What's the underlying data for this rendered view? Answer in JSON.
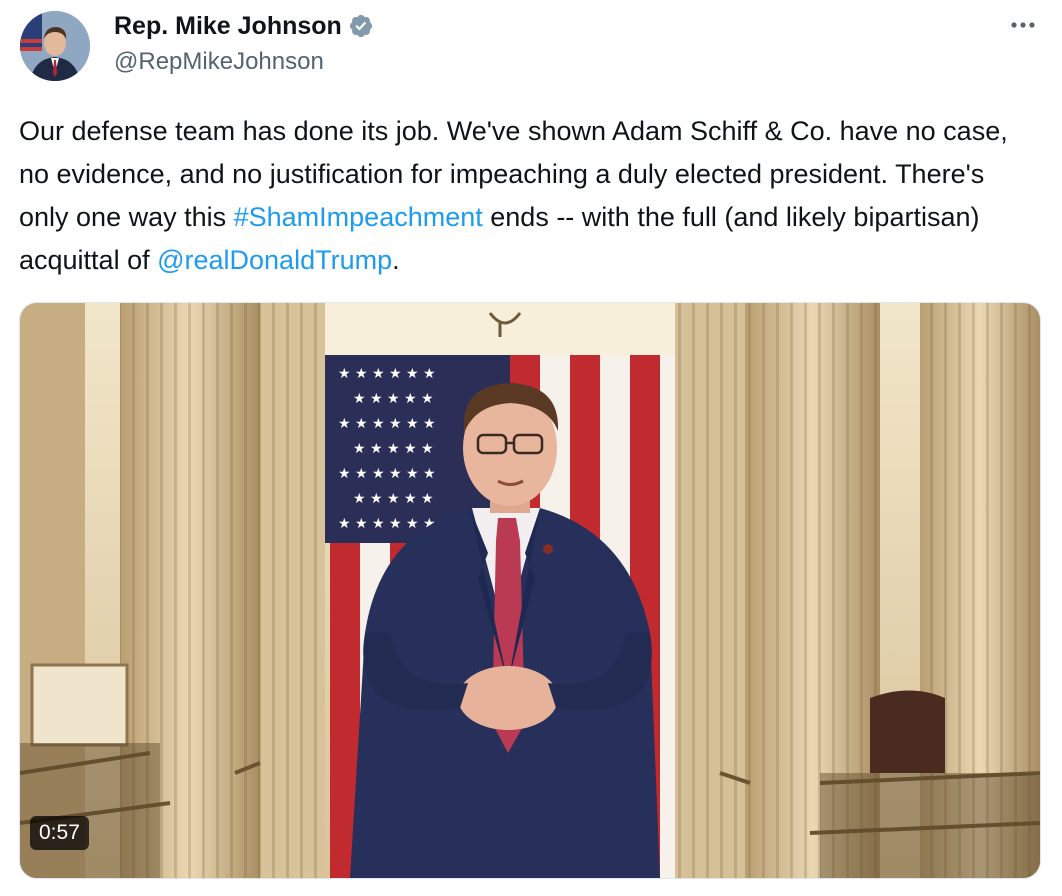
{
  "author": {
    "display_name": "Rep. Mike Johnson",
    "handle": "@RepMikeJohnson",
    "verified_icon": "verified-badge-icon",
    "avatar_icon": "profile-photo"
  },
  "menu": {
    "more_icon": "more-horizontal-icon"
  },
  "tweet": {
    "text_part1": "Our defense team has done its job. We've shown Adam Schiff & Co. have no case, no evidence, and no justification for impeaching a duly elected president. There's only one way this ",
    "hashtag": "#ShamImpeachment",
    "text_part2": " ends -- with the full (and likely bipartisan) acquittal of ",
    "mention": "@realDonaldTrump",
    "text_part3": "."
  },
  "media": {
    "type": "video",
    "duration": "0:57",
    "thumbnail_description_icon": "video-thumbnail"
  },
  "colors": {
    "link": "#1d9bf0",
    "text": "#0f1419",
    "secondary": "#536471",
    "verified": "#829aab"
  }
}
